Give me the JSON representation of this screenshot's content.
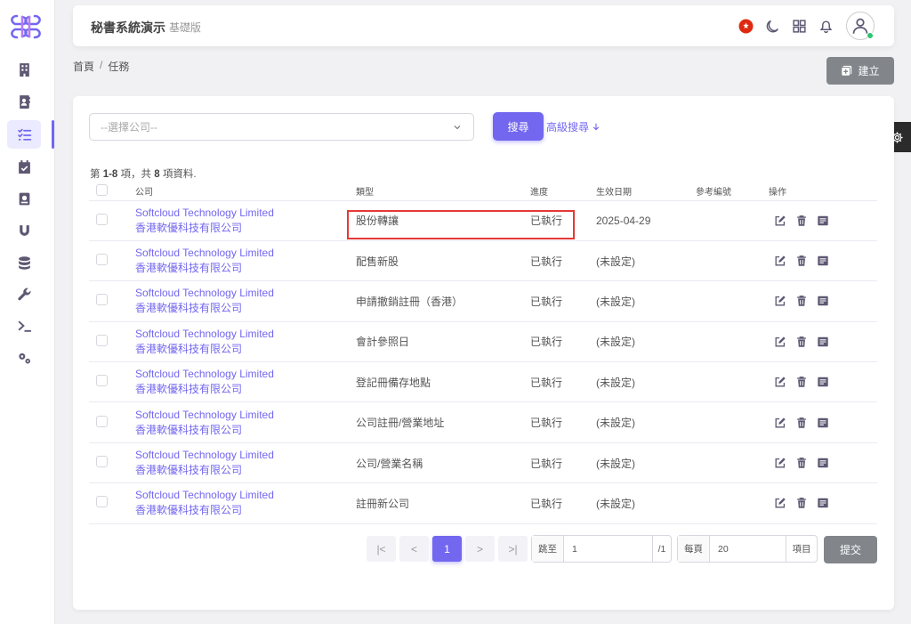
{
  "header": {
    "title": "秘書系統演示",
    "edition": "基礎版"
  },
  "breadcrumb": {
    "home": "首頁",
    "separator": "/",
    "current": "任務"
  },
  "create_button": "建立",
  "filter": {
    "company_placeholder": "--選擇公司--",
    "search_button": "搜尋",
    "advanced_search": "高級搜尋"
  },
  "summary": {
    "prefix": "第 ",
    "range": "1-8",
    "mid": " 項，共 ",
    "total": "8",
    "suffix": " 項資料."
  },
  "table": {
    "headers": [
      "公司",
      "類型",
      "進度",
      "生效日期",
      "參考編號",
      "操作"
    ],
    "rows": [
      {
        "company_en": "Softcloud Technology Limited",
        "company_zh": "香港軟優科技有限公司",
        "type": "股份轉讓",
        "progress": "已執行",
        "date": "2025-04-29",
        "ref": ""
      },
      {
        "company_en": "Softcloud Technology Limited",
        "company_zh": "香港軟優科技有限公司",
        "type": "配售新股",
        "progress": "已執行",
        "date": "(未設定)",
        "ref": ""
      },
      {
        "company_en": "Softcloud Technology Limited",
        "company_zh": "香港軟優科技有限公司",
        "type": "申請撤銷註冊（香港）",
        "progress": "已執行",
        "date": "(未設定)",
        "ref": ""
      },
      {
        "company_en": "Softcloud Technology Limited",
        "company_zh": "香港軟優科技有限公司",
        "type": "會計參照日",
        "progress": "已執行",
        "date": "(未設定)",
        "ref": ""
      },
      {
        "company_en": "Softcloud Technology Limited",
        "company_zh": "香港軟優科技有限公司",
        "type": "登記冊備存地點",
        "progress": "已執行",
        "date": "(未設定)",
        "ref": ""
      },
      {
        "company_en": "Softcloud Technology Limited",
        "company_zh": "香港軟優科技有限公司",
        "type": "公司註冊/營業地址",
        "progress": "已執行",
        "date": "(未設定)",
        "ref": ""
      },
      {
        "company_en": "Softcloud Technology Limited",
        "company_zh": "香港軟優科技有限公司",
        "type": "公司/營業名稱",
        "progress": "已執行",
        "date": "(未設定)",
        "ref": ""
      },
      {
        "company_en": "Softcloud Technology Limited",
        "company_zh": "香港軟優科技有限公司",
        "type": "註冊新公司",
        "progress": "已執行",
        "date": "(未設定)",
        "ref": ""
      }
    ]
  },
  "pagination": {
    "first": "|<",
    "prev": "<",
    "current": "1",
    "next": ">",
    "last": ">|",
    "jump_label": "跳至",
    "jump_value": "1",
    "jump_suffix": "/1",
    "perpage_label": "每頁",
    "perpage_value": "20",
    "perpage_suffix": "項目",
    "submit": "提交"
  },
  "colors": {
    "accent": "#7367f0",
    "highlight": "#e53935",
    "grey_button": "#82868b"
  },
  "icons": {
    "sidebar": [
      "building-icon",
      "contact-book-icon",
      "task-list-icon",
      "calendar-check-icon",
      "passbook-icon",
      "magnet-icon",
      "database-icon",
      "wrench-icon",
      "terminal-icon",
      "cogs-icon"
    ],
    "topbar": [
      "hong-kong-flag-icon",
      "moon-icon",
      "grid-icon",
      "bell-icon",
      "user-avatar-icon"
    ],
    "row_actions": [
      "edit-icon",
      "trash-icon",
      "details-icon"
    ]
  }
}
